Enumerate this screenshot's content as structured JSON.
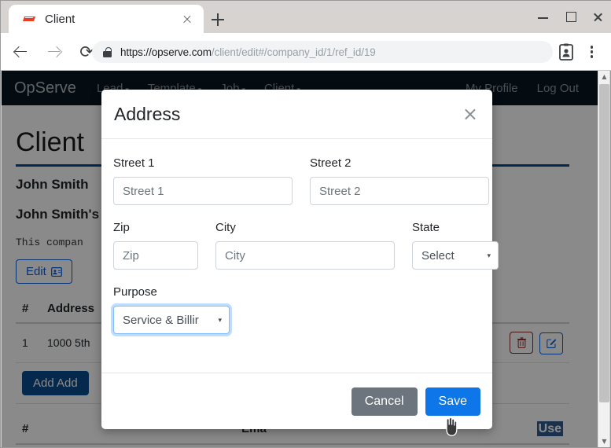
{
  "browser": {
    "tab": {
      "title": "Client",
      "favicon": "flame-favicon",
      "close_label": "×"
    },
    "new_tab_label": "+",
    "window": {
      "minimize": "–",
      "maximize": "□",
      "close": "×"
    },
    "nav": {
      "back": "back-arrow",
      "forward": "forward-arrow",
      "reload": "⟳"
    },
    "omnibox": {
      "security": "lock-icon",
      "scheme": "https://",
      "domain": "opserve.com",
      "path": "/client/edit#/company_id/1/ref_id/19",
      "full_url": "https://opserve.com/client/edit#/company_id/1/ref_id/19"
    },
    "profile_icon": "contact-card-icon",
    "menu_icon": "kebab-menu-icon"
  },
  "appnav": {
    "brand": "OpServe",
    "items": [
      {
        "label": "Lead",
        "caret": "▾"
      },
      {
        "label": "Template",
        "caret": "▾"
      },
      {
        "label": "Job",
        "caret": "▾"
      },
      {
        "label": "Client",
        "caret": "▾"
      }
    ],
    "right_items": [
      {
        "label": "My Profile"
      },
      {
        "label": "Log Out"
      }
    ]
  },
  "page": {
    "title": "Client",
    "client_name": "John Smith",
    "client_subtitle": "John Smith's",
    "description": "This compan",
    "edit_button": {
      "label": "Edit",
      "icon": "address-card-icon"
    },
    "address_table": {
      "headers": [
        "#",
        "Address"
      ],
      "rows": [
        {
          "num": "1",
          "address": "1000 5th"
        }
      ],
      "row_actions": {
        "delete": "trash-icon",
        "edit": "edit-square-icon"
      }
    },
    "add_address_button": "Add Add",
    "email_table": {
      "headers": [
        "#",
        "Ema"
      ]
    },
    "selected_text": "Use"
  },
  "modal": {
    "title": "Address",
    "close_label": "×",
    "fields": {
      "street1": {
        "label": "Street 1",
        "value": "",
        "placeholder": "Street 1"
      },
      "street2": {
        "label": "Street 2",
        "value": "",
        "placeholder": "Street 2"
      },
      "zip": {
        "label": "Zip",
        "value": "",
        "placeholder": "Zip"
      },
      "city": {
        "label": "City",
        "value": "",
        "placeholder": "City"
      },
      "state": {
        "label": "State",
        "selected": "Select",
        "arrow": "▾"
      },
      "purpose": {
        "label": "Purpose",
        "selected": "Service & Billir",
        "arrow": "▾",
        "focused": true
      }
    },
    "buttons": {
      "cancel": "Cancel",
      "save": "Save"
    }
  },
  "scrollbar": {
    "up": "▲",
    "down": "▼"
  },
  "colors": {
    "nav_bg": "#081621",
    "primary": "#0b4c8c",
    "save_blue": "#0d76e8",
    "cancel_gray": "#6c757d",
    "focus_blue": "#80bdff",
    "danger": "#9b2c2c",
    "selection": "#2f5b8c"
  }
}
